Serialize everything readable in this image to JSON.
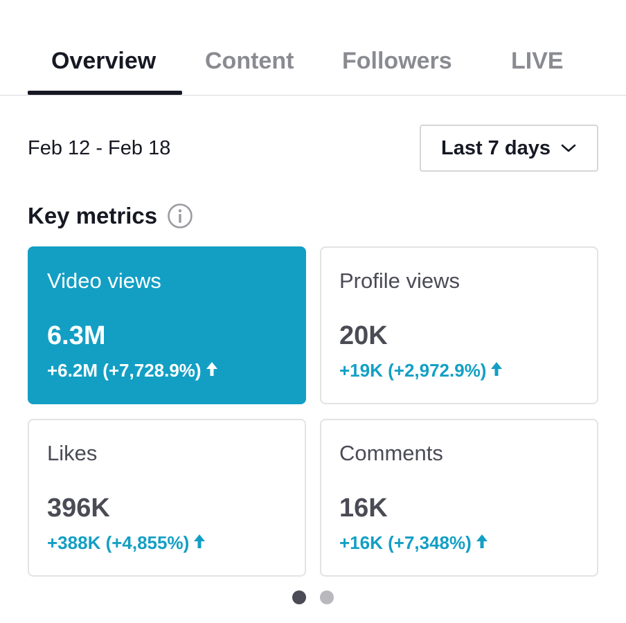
{
  "tabs": [
    {
      "label": "Overview",
      "active": true
    },
    {
      "label": "Content",
      "active": false
    },
    {
      "label": "Followers",
      "active": false
    },
    {
      "label": "LIVE",
      "active": false
    }
  ],
  "date_range": "Feb 12 - Feb 18",
  "period_select": {
    "value": "Last 7 days",
    "icon": "chevron-down-icon"
  },
  "key_metrics": {
    "title": "Key metrics",
    "info_icon": "info-icon",
    "cards": [
      {
        "label": "Video views",
        "value": "6.3M",
        "delta": "+6.2M (+7,728.9%)",
        "selected": true
      },
      {
        "label": "Profile views",
        "value": "20K",
        "delta": "+19K (+2,972.9%)",
        "selected": false
      },
      {
        "label": "Likes",
        "value": "396K",
        "delta": "+388K (+4,855%)",
        "selected": false
      },
      {
        "label": "Comments",
        "value": "16K",
        "delta": "+16K (+7,348%)",
        "selected": false
      }
    ]
  },
  "pagination": {
    "pages": 2,
    "current": 1
  },
  "colors": {
    "accent": "#139fc4",
    "text_primary": "#161823",
    "text_muted": "#8a8b91"
  }
}
